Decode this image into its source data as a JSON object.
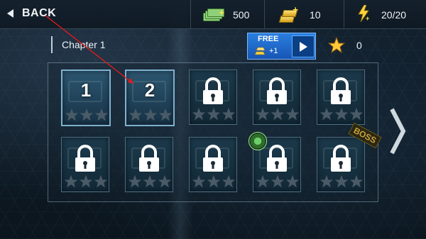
{
  "topbar": {
    "back_label": "BACK",
    "cash": "500",
    "gold": "10",
    "energy": "20/20"
  },
  "chapter": {
    "title": "Chapter 1"
  },
  "free_offer": {
    "free_label": "FREE",
    "reward_label": "+1"
  },
  "stars_total": "0",
  "levels": [
    {
      "label": "1",
      "locked": false,
      "stars": 0
    },
    {
      "label": "2",
      "locked": false,
      "stars": 0
    },
    {
      "label": "",
      "locked": true,
      "stars": 0
    },
    {
      "label": "",
      "locked": true,
      "stars": 0
    },
    {
      "label": "",
      "locked": true,
      "stars": 0
    },
    {
      "label": "",
      "locked": true,
      "stars": 0
    },
    {
      "label": "",
      "locked": true,
      "stars": 0
    },
    {
      "label": "",
      "locked": true,
      "stars": 0
    },
    {
      "label": "",
      "locked": true,
      "stars": 0
    },
    {
      "label": "",
      "locked": true,
      "stars": 0
    }
  ],
  "boss_label": "BOSS",
  "colors": {
    "accent_blue": "#1f6fd0",
    "gold": "#ffd23a",
    "star_empty": "#4a5a66"
  }
}
